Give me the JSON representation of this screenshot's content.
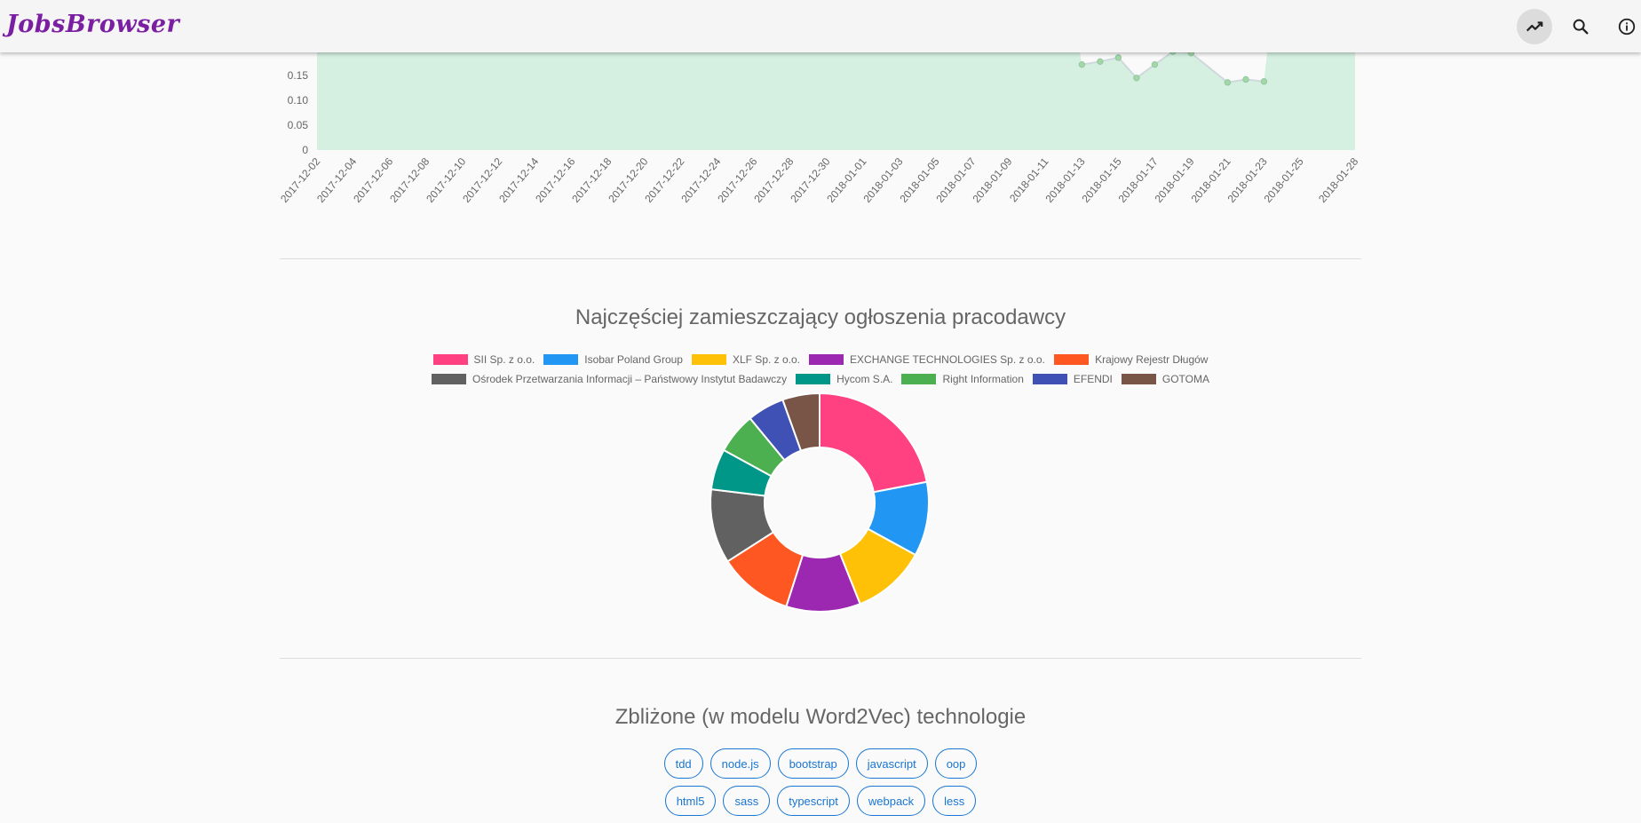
{
  "app": {
    "title": "JobsBrowser"
  },
  "toolbar": {
    "icons": [
      "trending-up-icon",
      "search-icon",
      "info-icon"
    ]
  },
  "line_chart": {
    "y_ticks": [
      "0",
      "0.05",
      "0.10",
      "0.15"
    ],
    "x_ticks": [
      "2017-12-02",
      "2017-12-04",
      "2017-12-06",
      "2017-12-08",
      "2017-12-10",
      "2017-12-12",
      "2017-12-14",
      "2017-12-16",
      "2017-12-18",
      "2017-12-20",
      "2017-12-22",
      "2017-12-24",
      "2017-12-26",
      "2017-12-28",
      "2017-12-30",
      "2018-01-01",
      "2018-01-03",
      "2018-01-05",
      "2018-01-07",
      "2018-01-09",
      "2018-01-11",
      "2018-01-13",
      "2018-01-15",
      "2018-01-17",
      "2018-01-19",
      "2018-01-21",
      "2018-01-23",
      "2018-01-25",
      "2018-01-28"
    ],
    "fill_color": "#d5f0e1",
    "line_color": "#cfd8dc",
    "points": [
      {
        "x": "2018-01-13",
        "y": 0.172
      },
      {
        "x": "2018-01-14",
        "y": 0.178
      },
      {
        "x": "2018-01-15",
        "y": 0.186
      },
      {
        "x": "2018-01-16",
        "y": 0.145
      },
      {
        "x": "2018-01-17",
        "y": 0.172
      },
      {
        "x": "2018-01-18",
        "y": 0.198
      },
      {
        "x": "2018-01-19",
        "y": 0.195
      },
      {
        "x": "2018-01-21",
        "y": 0.136
      },
      {
        "x": "2018-01-22",
        "y": 0.142
      },
      {
        "x": "2018-01-23",
        "y": 0.138
      }
    ]
  },
  "employers": {
    "title": "Najczęściej zamieszczający ogłoszenia pracodawcy",
    "chart_data": {
      "type": "pie",
      "labels": [
        "SII Sp. z o.o.",
        "Isobar Poland Group",
        "XLF Sp. z o.o.",
        "EXCHANGE TECHNOLOGIES Sp. z o.o.",
        "Krajowy Rejestr Długów",
        "Ośrodek Przetwarzania Informacji – Państwowy Instytut Badawczy",
        "Hycom S.A.",
        "Right Information",
        "EFENDI",
        "GOTOMA"
      ],
      "values": [
        20,
        10,
        10,
        10,
        10,
        10,
        5.5,
        5.5,
        5,
        5
      ],
      "colors": [
        "#ff4081",
        "#2196f3",
        "#ffc107",
        "#9c27b0",
        "#ff5722",
        "#616161",
        "#009688",
        "#4caf50",
        "#3f51b5",
        "#795548"
      ]
    }
  },
  "similar": {
    "title": "Zbliżone (w modelu Word2Vec) technologie",
    "rows": [
      [
        "tdd",
        "node.js",
        "bootstrap",
        "javascript",
        "oop"
      ],
      [
        "html5",
        "sass",
        "typescript",
        "webpack",
        "less"
      ]
    ]
  }
}
